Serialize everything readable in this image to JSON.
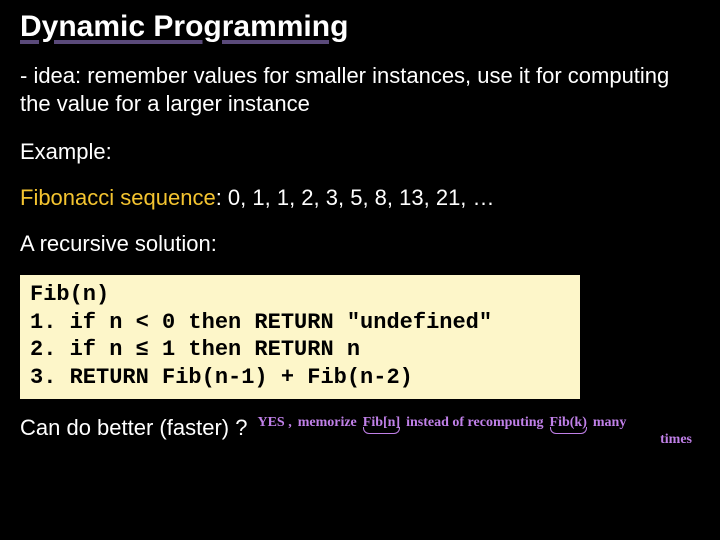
{
  "title": "Dynamic Programming",
  "idea": "- idea: remember values for smaller instances, use it for computing the value for a larger instance",
  "example_label": "Example:",
  "fibonacci_label": "Fibonacci sequence",
  "fibonacci_colon": ": ",
  "fibonacci_values": "0, 1, 1, 2, 3, 5, 8, 13, 21, …",
  "recursive_label": "A recursive solution:",
  "code": {
    "l0": "Fib(n)",
    "l1": "1. if n < 0 then RETURN \"undefined\"",
    "l2": "2. if n ≤ 1 then RETURN n",
    "l3": "3. RETURN Fib(n-1) + Fib(n-2)"
  },
  "question": "Can do better (faster) ?",
  "handwriting": {
    "yes": "YES ,",
    "memorize": "memorize",
    "fibn_box": "Fib[n]",
    "instead": "instead of recomputing",
    "fibk_box": "Fib(k)",
    "many": "many",
    "times": "times"
  }
}
